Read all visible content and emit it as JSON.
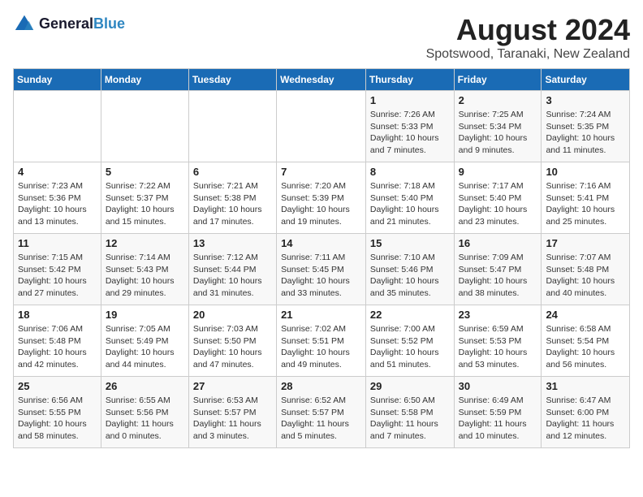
{
  "logo": {
    "line1": "General",
    "line2": "Blue"
  },
  "title": "August 2024",
  "subtitle": "Spotswood, Taranaki, New Zealand",
  "days_header": [
    "Sunday",
    "Monday",
    "Tuesday",
    "Wednesday",
    "Thursday",
    "Friday",
    "Saturday"
  ],
  "weeks": [
    [
      {
        "day": "",
        "info": ""
      },
      {
        "day": "",
        "info": ""
      },
      {
        "day": "",
        "info": ""
      },
      {
        "day": "",
        "info": ""
      },
      {
        "day": "1",
        "info": "Sunrise: 7:26 AM\nSunset: 5:33 PM\nDaylight: 10 hours\nand 7 minutes."
      },
      {
        "day": "2",
        "info": "Sunrise: 7:25 AM\nSunset: 5:34 PM\nDaylight: 10 hours\nand 9 minutes."
      },
      {
        "day": "3",
        "info": "Sunrise: 7:24 AM\nSunset: 5:35 PM\nDaylight: 10 hours\nand 11 minutes."
      }
    ],
    [
      {
        "day": "4",
        "info": "Sunrise: 7:23 AM\nSunset: 5:36 PM\nDaylight: 10 hours\nand 13 minutes."
      },
      {
        "day": "5",
        "info": "Sunrise: 7:22 AM\nSunset: 5:37 PM\nDaylight: 10 hours\nand 15 minutes."
      },
      {
        "day": "6",
        "info": "Sunrise: 7:21 AM\nSunset: 5:38 PM\nDaylight: 10 hours\nand 17 minutes."
      },
      {
        "day": "7",
        "info": "Sunrise: 7:20 AM\nSunset: 5:39 PM\nDaylight: 10 hours\nand 19 minutes."
      },
      {
        "day": "8",
        "info": "Sunrise: 7:18 AM\nSunset: 5:40 PM\nDaylight: 10 hours\nand 21 minutes."
      },
      {
        "day": "9",
        "info": "Sunrise: 7:17 AM\nSunset: 5:40 PM\nDaylight: 10 hours\nand 23 minutes."
      },
      {
        "day": "10",
        "info": "Sunrise: 7:16 AM\nSunset: 5:41 PM\nDaylight: 10 hours\nand 25 minutes."
      }
    ],
    [
      {
        "day": "11",
        "info": "Sunrise: 7:15 AM\nSunset: 5:42 PM\nDaylight: 10 hours\nand 27 minutes."
      },
      {
        "day": "12",
        "info": "Sunrise: 7:14 AM\nSunset: 5:43 PM\nDaylight: 10 hours\nand 29 minutes."
      },
      {
        "day": "13",
        "info": "Sunrise: 7:12 AM\nSunset: 5:44 PM\nDaylight: 10 hours\nand 31 minutes."
      },
      {
        "day": "14",
        "info": "Sunrise: 7:11 AM\nSunset: 5:45 PM\nDaylight: 10 hours\nand 33 minutes."
      },
      {
        "day": "15",
        "info": "Sunrise: 7:10 AM\nSunset: 5:46 PM\nDaylight: 10 hours\nand 35 minutes."
      },
      {
        "day": "16",
        "info": "Sunrise: 7:09 AM\nSunset: 5:47 PM\nDaylight: 10 hours\nand 38 minutes."
      },
      {
        "day": "17",
        "info": "Sunrise: 7:07 AM\nSunset: 5:48 PM\nDaylight: 10 hours\nand 40 minutes."
      }
    ],
    [
      {
        "day": "18",
        "info": "Sunrise: 7:06 AM\nSunset: 5:48 PM\nDaylight: 10 hours\nand 42 minutes."
      },
      {
        "day": "19",
        "info": "Sunrise: 7:05 AM\nSunset: 5:49 PM\nDaylight: 10 hours\nand 44 minutes."
      },
      {
        "day": "20",
        "info": "Sunrise: 7:03 AM\nSunset: 5:50 PM\nDaylight: 10 hours\nand 47 minutes."
      },
      {
        "day": "21",
        "info": "Sunrise: 7:02 AM\nSunset: 5:51 PM\nDaylight: 10 hours\nand 49 minutes."
      },
      {
        "day": "22",
        "info": "Sunrise: 7:00 AM\nSunset: 5:52 PM\nDaylight: 10 hours\nand 51 minutes."
      },
      {
        "day": "23",
        "info": "Sunrise: 6:59 AM\nSunset: 5:53 PM\nDaylight: 10 hours\nand 53 minutes."
      },
      {
        "day": "24",
        "info": "Sunrise: 6:58 AM\nSunset: 5:54 PM\nDaylight: 10 hours\nand 56 minutes."
      }
    ],
    [
      {
        "day": "25",
        "info": "Sunrise: 6:56 AM\nSunset: 5:55 PM\nDaylight: 10 hours\nand 58 minutes."
      },
      {
        "day": "26",
        "info": "Sunrise: 6:55 AM\nSunset: 5:56 PM\nDaylight: 11 hours\nand 0 minutes."
      },
      {
        "day": "27",
        "info": "Sunrise: 6:53 AM\nSunset: 5:57 PM\nDaylight: 11 hours\nand 3 minutes."
      },
      {
        "day": "28",
        "info": "Sunrise: 6:52 AM\nSunset: 5:57 PM\nDaylight: 11 hours\nand 5 minutes."
      },
      {
        "day": "29",
        "info": "Sunrise: 6:50 AM\nSunset: 5:58 PM\nDaylight: 11 hours\nand 7 minutes."
      },
      {
        "day": "30",
        "info": "Sunrise: 6:49 AM\nSunset: 5:59 PM\nDaylight: 11 hours\nand 10 minutes."
      },
      {
        "day": "31",
        "info": "Sunrise: 6:47 AM\nSunset: 6:00 PM\nDaylight: 11 hours\nand 12 minutes."
      }
    ]
  ]
}
